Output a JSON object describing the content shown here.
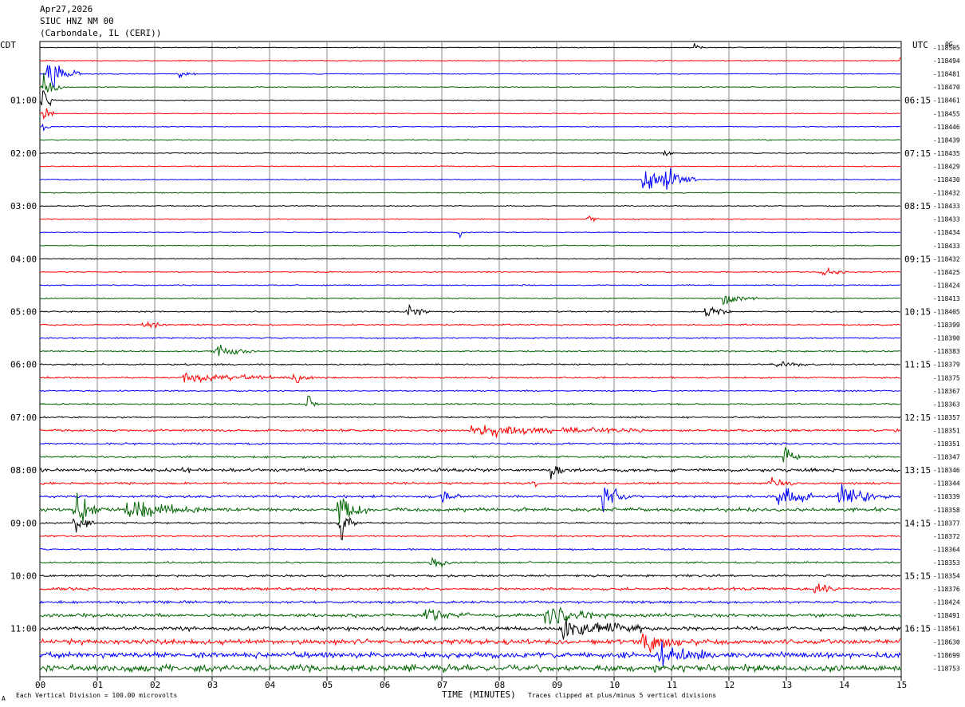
{
  "header": {
    "date": "Apr27,2026",
    "station": "SIUC HNZ NM 00",
    "location": "(Carbondale, IL (CERI))",
    "left_zone": "CDT",
    "right_zone": "UTC",
    "corner_tag": "0G"
  },
  "footer": {
    "scale_note": "Each Vertical Division =  100.00 microvolts",
    "clip_note": "Traces clipped at plus/minus 5 vertical divisions",
    "corner_mark": "A"
  },
  "chart_data": {
    "type": "line",
    "title": "",
    "xlabel": "TIME (MINUTES)",
    "ylabel": "",
    "xlim": [
      0,
      15
    ],
    "x_ticks": [
      "00",
      "01",
      "02",
      "03",
      "04",
      "05",
      "06",
      "07",
      "08",
      "09",
      "10",
      "11",
      "12",
      "13",
      "14",
      "15"
    ],
    "grid": true,
    "trace_colors": [
      "#000000",
      "#ff0000",
      "#0000ff",
      "#006400"
    ],
    "left_hour_labels": [
      "01:00",
      "02:00",
      "03:00",
      "04:00",
      "05:00",
      "06:00",
      "07:00",
      "08:00",
      "09:00",
      "10:00",
      "11:00"
    ],
    "right_hour_labels": [
      "06:15",
      "07:15",
      "08:15",
      "09:15",
      "10:15",
      "11:15",
      "12:15",
      "13:15",
      "14:15",
      "15:15",
      "16:15"
    ],
    "hour_label_first_row": 4,
    "rows_per_hour": 4,
    "right_counts": [
      "-118505",
      "-118494",
      "-118481",
      "-118470",
      "-118461",
      "-118455",
      "-118446",
      "-118439",
      "-118435",
      "-118429",
      "-118430",
      "-118432",
      "-118433",
      "-118433",
      "-118434",
      "-118433",
      "-118432",
      "-118425",
      "-118424",
      "-118413",
      "-118405",
      "-118399",
      "-118390",
      "-118383",
      "-118379",
      "-118375",
      "-118367",
      "-118363",
      "-118357",
      "-118351",
      "-118351",
      "-118347",
      "-118346",
      "-118344",
      "-118339",
      "-118358",
      "-118377",
      "-118372",
      "-118364",
      "-118353",
      "-118354",
      "-118376",
      "-118424",
      "-118491",
      "-118561",
      "-118630",
      "-118699",
      "-118753"
    ],
    "noise_level": [
      0.25,
      0.25,
      0.25,
      0.25,
      0.25,
      0.25,
      0.25,
      0.28,
      0.28,
      0.28,
      0.28,
      0.28,
      0.28,
      0.28,
      0.28,
      0.3,
      0.3,
      0.32,
      0.32,
      0.32,
      0.38,
      0.4,
      0.38,
      0.42,
      0.42,
      0.45,
      0.38,
      0.42,
      0.42,
      0.65,
      0.5,
      0.55,
      0.9,
      0.6,
      0.7,
      1.0,
      0.45,
      0.42,
      0.45,
      0.5,
      0.6,
      0.75,
      0.7,
      0.95,
      1.1,
      1.4,
      1.6,
      1.8
    ],
    "events": [
      {
        "row": 0,
        "minute": 11.4,
        "amp": 1.5,
        "dur": 0.2
      },
      {
        "row": 1,
        "minute": 15.0,
        "amp": 4.0,
        "dur": 0.08
      },
      {
        "row": 2,
        "minute": 0.12,
        "amp": 5.0,
        "dur": 0.6
      },
      {
        "row": 2,
        "minute": 2.4,
        "amp": 1.2,
        "dur": 0.3
      },
      {
        "row": 3,
        "minute": 0.05,
        "amp": 5.0,
        "dur": 0.35
      },
      {
        "row": 4,
        "minute": 0.03,
        "amp": 5.0,
        "dur": 0.25
      },
      {
        "row": 5,
        "minute": 0.05,
        "amp": 3.0,
        "dur": 0.2
      },
      {
        "row": 6,
        "minute": 0.05,
        "amp": 2.0,
        "dur": 0.15
      },
      {
        "row": 10,
        "minute": 10.5,
        "amp": 5.0,
        "dur": 0.5
      },
      {
        "row": 10,
        "minute": 10.85,
        "amp": 5.0,
        "dur": 0.6
      },
      {
        "row": 8,
        "minute": 10.85,
        "amp": 1.5,
        "dur": 0.2
      },
      {
        "row": 13,
        "minute": 9.55,
        "amp": 1.2,
        "dur": 0.2
      },
      {
        "row": 14,
        "minute": 7.3,
        "amp": 1.5,
        "dur": 0.15
      },
      {
        "row": 17,
        "minute": 13.6,
        "amp": 1.3,
        "dur": 0.5
      },
      {
        "row": 19,
        "minute": 11.9,
        "amp": 2.0,
        "dur": 0.6
      },
      {
        "row": 20,
        "minute": 6.4,
        "amp": 2.0,
        "dur": 0.4
      },
      {
        "row": 20,
        "minute": 11.6,
        "amp": 1.6,
        "dur": 0.5
      },
      {
        "row": 21,
        "minute": 1.8,
        "amp": 1.5,
        "dur": 0.4
      },
      {
        "row": 23,
        "minute": 3.0,
        "amp": 1.8,
        "dur": 0.8
      },
      {
        "row": 24,
        "minute": 12.8,
        "amp": 1.4,
        "dur": 0.8
      },
      {
        "row": 25,
        "minute": 2.5,
        "amp": 1.5,
        "dur": 2.0
      },
      {
        "row": 25,
        "minute": 4.4,
        "amp": 2.0,
        "dur": 0.4
      },
      {
        "row": 27,
        "minute": 4.65,
        "amp": 3.0,
        "dur": 0.2
      },
      {
        "row": 29,
        "minute": 7.5,
        "amp": 1.5,
        "dur": 3.0
      },
      {
        "row": 31,
        "minute": 12.95,
        "amp": 4.0,
        "dur": 0.3
      },
      {
        "row": 32,
        "minute": 2.5,
        "amp": 3.0,
        "dur": 0.1
      },
      {
        "row": 32,
        "minute": 8.9,
        "amp": 3.0,
        "dur": 0.3
      },
      {
        "row": 33,
        "minute": 8.6,
        "amp": 2.5,
        "dur": 0.1
      },
      {
        "row": 33,
        "minute": 12.7,
        "amp": 2.0,
        "dur": 0.5
      },
      {
        "row": 34,
        "minute": 9.8,
        "amp": 5.0,
        "dur": 0.5
      },
      {
        "row": 34,
        "minute": 12.85,
        "amp": 4.0,
        "dur": 0.6
      },
      {
        "row": 34,
        "minute": 13.9,
        "amp": 3.0,
        "dur": 1.0
      },
      {
        "row": 34,
        "minute": 7.0,
        "amp": 2.0,
        "dur": 0.3
      },
      {
        "row": 35,
        "minute": 0.6,
        "amp": 5.0,
        "dur": 0.6
      },
      {
        "row": 35,
        "minute": 1.5,
        "amp": 2.5,
        "dur": 1.5
      },
      {
        "row": 35,
        "minute": 5.2,
        "amp": 5.0,
        "dur": 0.5
      },
      {
        "row": 36,
        "minute": 0.6,
        "amp": 4.0,
        "dur": 0.4
      },
      {
        "row": 36,
        "minute": 5.2,
        "amp": 5.0,
        "dur": 0.4
      },
      {
        "row": 39,
        "minute": 6.8,
        "amp": 2.0,
        "dur": 0.4
      },
      {
        "row": 41,
        "minute": 13.5,
        "amp": 2.0,
        "dur": 0.4
      },
      {
        "row": 43,
        "minute": 6.7,
        "amp": 2.0,
        "dur": 0.8
      },
      {
        "row": 43,
        "minute": 8.8,
        "amp": 2.5,
        "dur": 1.2
      },
      {
        "row": 44,
        "minute": 9.1,
        "amp": 3.0,
        "dur": 1.5
      },
      {
        "row": 45,
        "minute": 10.5,
        "amp": 2.5,
        "dur": 1.0
      },
      {
        "row": 46,
        "minute": 10.8,
        "amp": 3.0,
        "dur": 0.8
      }
    ]
  }
}
